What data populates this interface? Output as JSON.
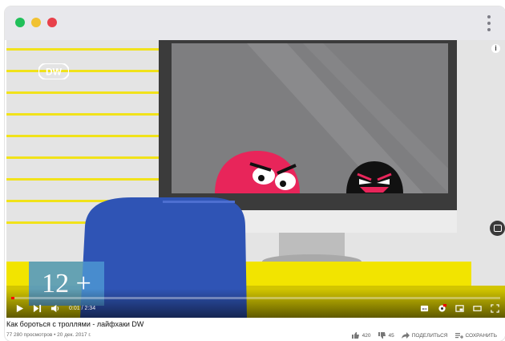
{
  "window": {
    "controls": [
      "close",
      "minimize",
      "maximize"
    ],
    "menu_icon": "kebab-menu-icon"
  },
  "video": {
    "logo_text": "DW",
    "age_rating": "12 +",
    "progress_fraction": 0.007,
    "time": "0:01 / 2:34"
  },
  "meta": {
    "title": "Как бороться с троллями - лайфхаки DW",
    "views": "77 280 просмотров • 20 дек. 2017 г.",
    "likes": "420",
    "dislikes": "45",
    "share": "ПОДЕЛИТЬСЯ",
    "save": "СОХРАНИТЬ"
  },
  "colors": {
    "accent": "#ff0000",
    "troll_pink": "#e8255a",
    "troll_black": "#111111",
    "chair_blue": "#2f54b5",
    "stripe_yellow": "#f2e400"
  }
}
